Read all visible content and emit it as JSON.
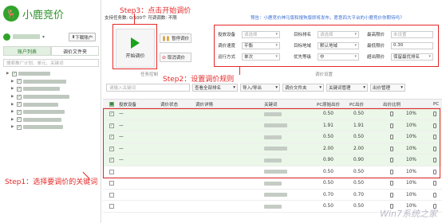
{
  "app": {
    "name": "小鹿竞价",
    "logo_icon": "deer-icon"
  },
  "sidebar": {
    "download_label": "下载账户",
    "tabs": [
      "账户列表",
      "调价文件夹"
    ],
    "search_placeholder": "搜索推广计划、单元、关键词",
    "tree_rows": 8
  },
  "header": {
    "task_text": "支持任务数: 0/100个   可调调数: 不限",
    "notice": "预告：小鹿竞价神马版和搜狗版即将发布，愿意四大平台的小鹿竞价你期待吗？"
  },
  "toolbar": {
    "start_label": "开始调价",
    "pause_label": "暂停调价",
    "cancel_label": "取消调价",
    "task_control_label": "任务控制",
    "price_settings_label": "调价设置"
  },
  "settings": {
    "rows": [
      [
        {
          "label": "投放设备",
          "value": "请选择",
          "placeholder": true
        },
        {
          "label": "目标排名",
          "value": "请选择",
          "placeholder": true
        },
        {
          "label": "最高限价",
          "value": "未设置",
          "placeholder": true,
          "arrow": false
        }
      ],
      [
        {
          "label": "调价速度",
          "value": "平衡"
        },
        {
          "label": "目标地域",
          "value": "默认地域"
        },
        {
          "label": "最低限价",
          "value": "0.30",
          "arrow": false
        }
      ],
      [
        {
          "label": "运行方式",
          "value": "单次"
        },
        {
          "label": "优先等级",
          "value": "中"
        },
        {
          "label": "超出限价",
          "value": "保留最优排名"
        }
      ]
    ]
  },
  "filter": {
    "keyword_placeholder": "请输入关键词",
    "buttons": [
      "查看全部排名",
      "导入/导出",
      "调价文件夹",
      "关键词管理",
      "出价管理"
    ]
  },
  "table": {
    "columns": [
      "投放设备",
      "调价状态",
      "调价详情",
      "关键词",
      "PC原始出价",
      "PC出价",
      "出价比例",
      "PC"
    ],
    "rows": [
      {
        "checked": true,
        "orig": "0.50",
        "bid": "0.50",
        "ratio": "10%"
      },
      {
        "checked": true,
        "orig": "1.91",
        "bid": "1.91",
        "ratio": "10%"
      },
      {
        "checked": true,
        "orig": "0.50",
        "bid": "0.50",
        "ratio": "10%"
      },
      {
        "checked": true,
        "orig": "2.00",
        "bid": "2.00",
        "ratio": "10%"
      },
      {
        "checked": true,
        "orig": "0.90",
        "bid": "0.90",
        "ratio": "10%"
      },
      {
        "checked": false,
        "orig": "0.50",
        "bid": "0.50",
        "ratio": "10%"
      },
      {
        "checked": false,
        "orig": "0.50",
        "bid": "0.50",
        "ratio": "10%"
      },
      {
        "checked": false,
        "orig": "0.70",
        "bid": "0.70",
        "ratio": "10%"
      },
      {
        "checked": false,
        "orig": "0.50",
        "bid": "0.50",
        "ratio": "10%"
      }
    ]
  },
  "annotations": {
    "step1": "Step1：选择要调价的关键词",
    "step2": "Step2：设置调价规则",
    "step3": "Step3：点击开始调价",
    "color": "#e62828"
  },
  "watermark": "Win7系统之家"
}
